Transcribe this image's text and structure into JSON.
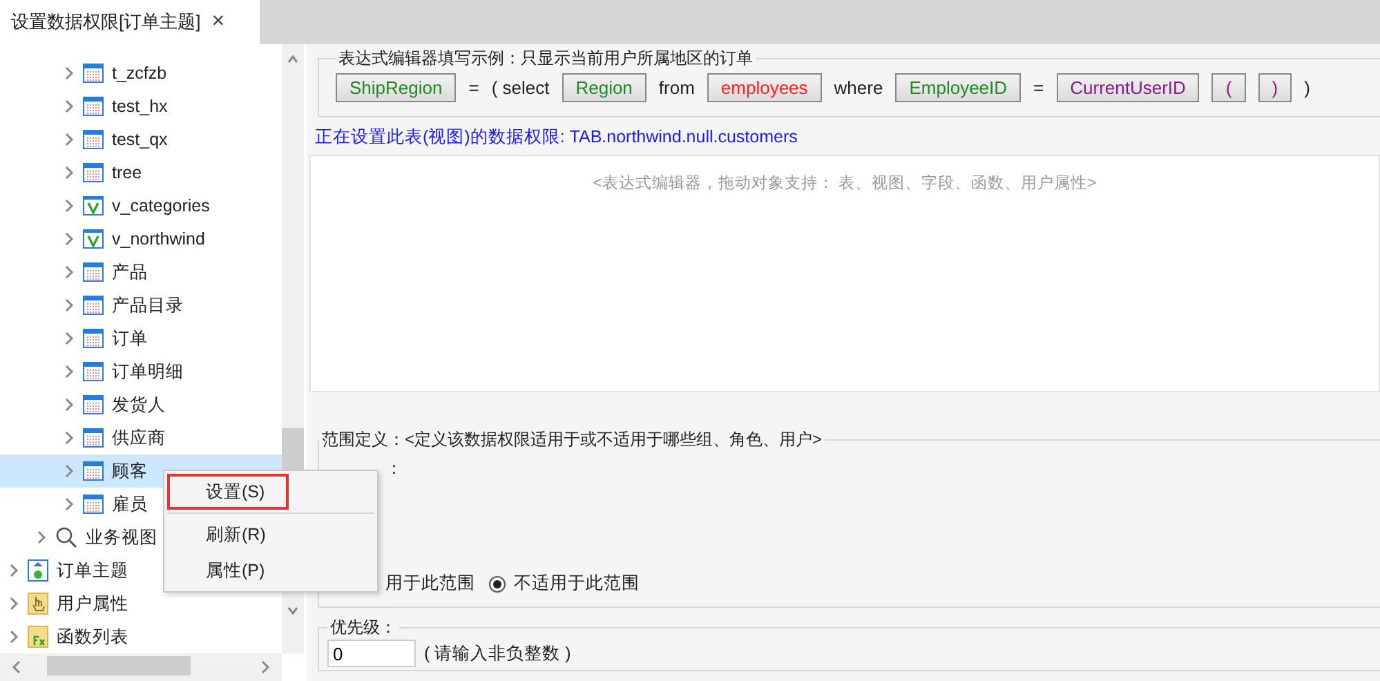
{
  "tab": {
    "title": "设置数据权限[订单主题]",
    "close": "×"
  },
  "tree": [
    {
      "children": [
        {
          "children": [
            {
              "label": "t_zcfzb",
              "kind": "table"
            },
            {
              "label": "test_hx",
              "kind": "table"
            },
            {
              "label": "test_qx",
              "kind": "table"
            },
            {
              "label": "tree",
              "kind": "table"
            },
            {
              "label": "v_categories",
              "kind": "view"
            },
            {
              "label": "v_northwind",
              "kind": "view"
            },
            {
              "label": "产品",
              "kind": "table"
            },
            {
              "label": "产品目录",
              "kind": "table"
            },
            {
              "label": "订单",
              "kind": "table"
            },
            {
              "label": "订单明细",
              "kind": "table"
            },
            {
              "label": "发货人",
              "kind": "table"
            },
            {
              "label": "供应商",
              "kind": "table"
            },
            {
              "label": "顾客",
              "kind": "table",
              "selected": true
            },
            {
              "label": "雇员",
              "kind": "table"
            }
          ]
        },
        {
          "label": "业务视图",
          "kind": "search"
        }
      ]
    },
    {
      "label": "订单主题",
      "kind": "subject"
    },
    {
      "label": "用户属性",
      "kind": "hand"
    },
    {
      "label": "函数列表",
      "kind": "function"
    }
  ],
  "context_menu": [
    {
      "label": "设置(S)",
      "selected": true
    },
    {
      "label": "刷新(R)",
      "selected": false
    },
    {
      "label": "属性(P)",
      "selected": false
    }
  ],
  "example": {
    "legend": "表达式编辑器填写示例：只显示当前用户所属地区的订单",
    "tokens": [
      {
        "kind": "field",
        "text": "ShipRegion"
      },
      {
        "kind": "text",
        "text": "="
      },
      {
        "kind": "text",
        "text": "( select"
      },
      {
        "kind": "field",
        "text": "Region"
      },
      {
        "kind": "text",
        "text": "from"
      },
      {
        "kind": "table",
        "text": "employees"
      },
      {
        "kind": "text",
        "text": "where"
      },
      {
        "kind": "field",
        "text": "EmployeeID"
      },
      {
        "kind": "text",
        "text": "="
      },
      {
        "kind": "variable",
        "text": "CurrentUserID"
      },
      {
        "kind": "paren",
        "text": "("
      },
      {
        "kind": "paren",
        "text": ")"
      },
      {
        "kind": "text",
        "text": ")"
      }
    ]
  },
  "status_line": "正在设置此表(视图)的数据权限: TAB.northwind.null.customers",
  "editor": {
    "placeholder": "<表达式编辑器，拖动对象支持： 表、视图、字段、函数、用户属性>"
  },
  "scope": {
    "legend": "范围定义：<定义该数据权限适用于或不适用于哪些组、角色、用户>",
    "group_label": "：",
    "covered_option_text": "用于此范围",
    "option": {
      "label": "不适用于此范围",
      "selected": true
    }
  },
  "priority": {
    "legend": "优先级：",
    "value": "0",
    "hint": "( 请输入非负整数 )"
  }
}
